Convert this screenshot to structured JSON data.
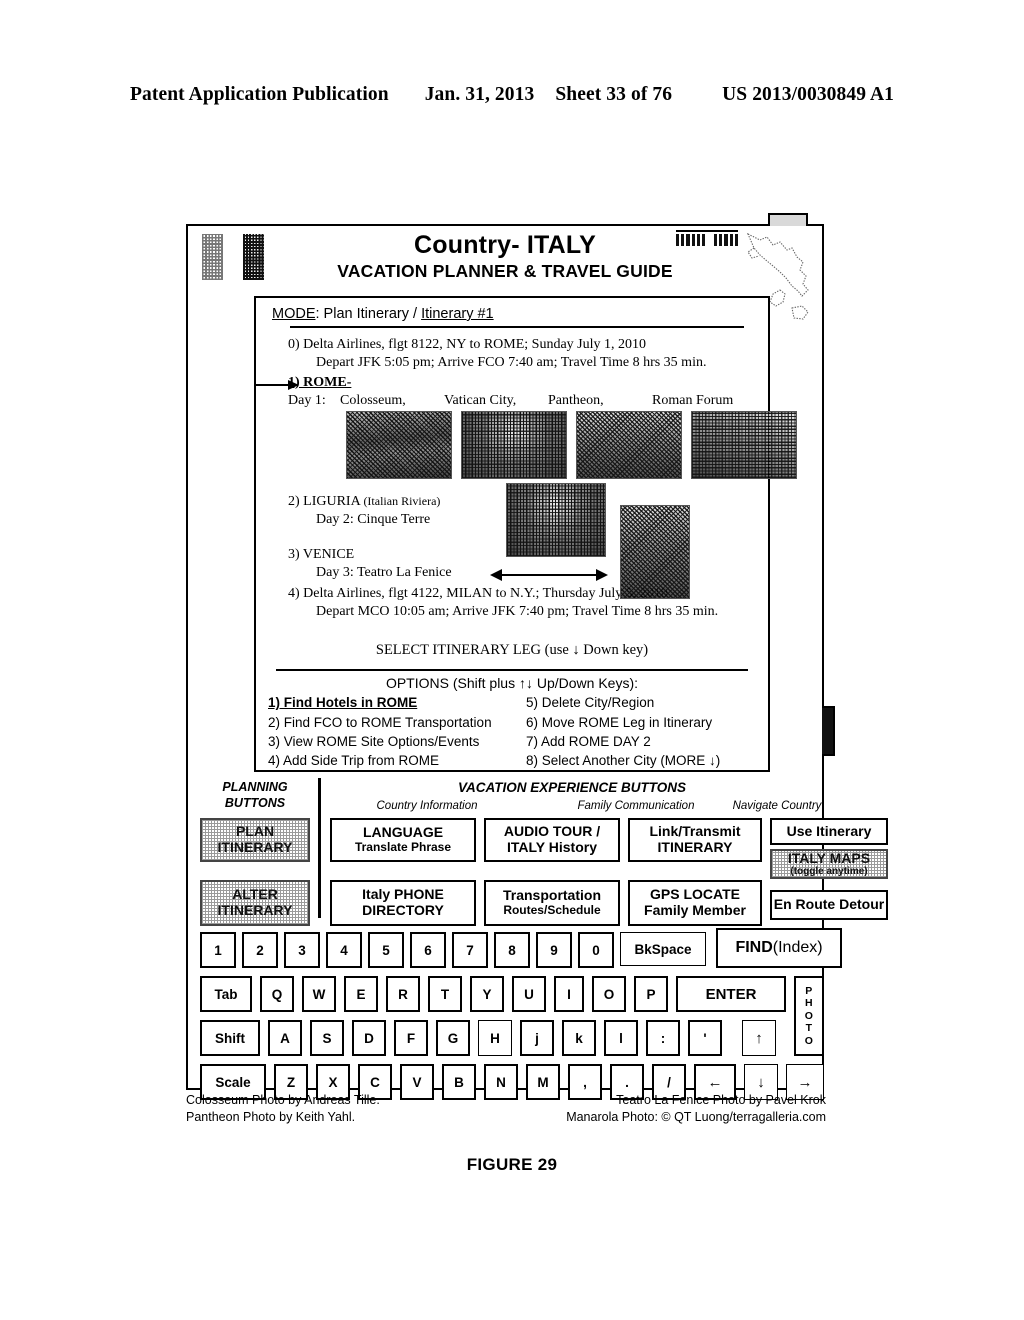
{
  "patent_header": {
    "left": "Patent Application Publication",
    "date": "Jan. 31, 2013",
    "sheet": "Sheet 33 of 76",
    "number": "US 2013/0030849 A1"
  },
  "figure_caption": "FIGURE 29",
  "device": {
    "header": {
      "title": "Country- ITALY",
      "subtitle": "VACATION PLANNER & TRAVEL GUIDE",
      "flag_icon": "italy-flag-icon",
      "signal_icon": "signal-bars-icon",
      "map_icon": "italy-map-outline-icon"
    },
    "panel": {
      "mode_label": "MODE",
      "mode_value": ": Plan Itinerary / ",
      "itinerary_name": "Itinerary #1",
      "legs": {
        "leg0_line1": "0) Delta Airlines, flgt 8122, NY to ROME; Sunday July 1, 2010",
        "leg0_line2": "Depart JFK 5:05 pm; Arrive FCO 7:40 am; Travel Time 8 hrs 35 min.",
        "leg1_label": "1) ROME-",
        "leg1_day": "Day 1:",
        "sites": [
          "Colosseum,",
          "Vatican City,",
          "Pantheon,",
          "Roman Forum"
        ],
        "leg2_label": "2) LIGURIA",
        "leg2_sub": "(Italian Riviera)",
        "leg2_day": "Day 2: Cinque Terre",
        "leg3_label": "3) VENICE",
        "leg3_day": "Day 3: Teatro La Fenice",
        "leg4_line1": "4) Delta Airlines, flgt 4122, MILAN to N.Y.; Thursday July 5, 2010",
        "leg4_line2": "Depart MCO 10:05 am; Arrive JFK 7:40 pm; Travel Time 8 hrs 35 min."
      },
      "select_leg": "SELECT ITINERARY LEG (use ↓ Down key)",
      "options_header": "OPTIONS (Shift plus ↑↓ Up/Down Keys):",
      "options_left": [
        "1) Find Hotels in ROME",
        "2) Find FCO to ROME Transportation",
        "3) View ROME Site Options/Events",
        "4) Add Side Trip from ROME"
      ],
      "options_right": [
        "5) Delete City/Region",
        "6) Move ROME Leg in Itinerary",
        "7) Add ROME DAY 2",
        "8) Select Another City   (MORE ↓)"
      ],
      "selected_option_index": 0
    },
    "deck": {
      "planning_label_1": "PLANNING",
      "planning_label_2": "BUTTONS",
      "experience_label": "VACATION EXPERIENCE BUTTONS",
      "group_labels": [
        "Country Information",
        "Family Communication",
        "Navigate Country"
      ],
      "planning_buttons": [
        {
          "l1": "PLAN",
          "l2": "ITINERARY",
          "shaded": true
        },
        {
          "l1": "ALTER",
          "l2": "ITINERARY",
          "shaded": true
        }
      ],
      "experience_buttons_row1": [
        {
          "l1": "LANGUAGE",
          "l2": "Translate Phrase",
          "shaded": false
        },
        {
          "l1": "AUDIO TOUR /",
          "l2": "ITALY History",
          "shaded": false
        },
        {
          "l1": "Link/Transmit",
          "l2": "ITINERARY",
          "shaded": false
        },
        {
          "l1": "Use Itinerary",
          "l2": "",
          "shaded": false
        }
      ],
      "experience_buttons_row2": [
        {
          "l1": "Italy PHONE",
          "l2": "DIRECTORY",
          "shaded": false
        },
        {
          "l1": "Transportation",
          "l2": "Routes/Schedule",
          "shaded": false
        },
        {
          "l1": "GPS LOCATE",
          "l2": "Family Member",
          "shaded": false
        },
        {
          "l1": "ITALY MAPS",
          "l2": "(toggle anytime)",
          "shaded": true
        },
        {
          "l1": "En Route Detour",
          "l2": "",
          "shaded": false
        }
      ],
      "keyboard": {
        "row1": [
          "1",
          "2",
          "3",
          "4",
          "5",
          "6",
          "7",
          "8",
          "9",
          "0",
          "BkSpace"
        ],
        "find_key_main": "FIND",
        "find_key_sub": " (Index)",
        "row2": [
          "Tab",
          "Q",
          "W",
          "E",
          "R",
          "T",
          "Y",
          "U",
          "I",
          "O",
          "P"
        ],
        "enter_key": "ENTER",
        "photo_key": "PHOTO",
        "row3": [
          "Shift",
          "A",
          "S",
          "D",
          "F",
          "G",
          "H",
          "j",
          "k",
          "l",
          ":",
          "'",
          "↑"
        ],
        "row4": [
          "Scale",
          "Z",
          "X",
          "C",
          "V",
          "B",
          "N",
          "M",
          ",",
          ".",
          "/",
          "←",
          "↓",
          "→"
        ]
      }
    }
  },
  "credits": {
    "left_1": "Colosseum Photo by Andreas Tille.",
    "left_2": "Pantheon Photo by Keith Yahl.",
    "right_1": "Teatro La Fenice Photo by Pavel Krok",
    "right_2": "Manarola Photo: © QT Luong/terragalleria.com"
  }
}
